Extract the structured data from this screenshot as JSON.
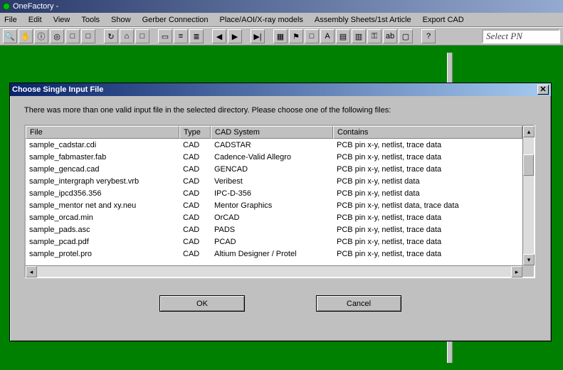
{
  "app": {
    "title": "OneFactory -"
  },
  "menus": [
    "File",
    "Edit",
    "View",
    "Tools",
    "Show",
    "Gerber Connection",
    "Place/AOI/X-ray models",
    "Assembly Sheets/1st Article",
    "Export CAD"
  ],
  "toolbar": {
    "icons": [
      "magnifier-icon",
      "hand-icon",
      "info-icon",
      "target-icon",
      "blank-icon",
      "blank-icon",
      "sep",
      "refresh-icon",
      "home-icon",
      "blank-icon",
      "sep",
      "rect-icon",
      "tool-a-icon",
      "tool-b-icon",
      "sep",
      "prev-icon",
      "next-icon",
      "sep",
      "step-icon",
      "sep",
      "layers-icon",
      "flag-icon",
      "blank-icon",
      "align-icon",
      "grid-icon",
      "table-icon",
      "key-icon",
      "text-icon",
      "color-icon",
      "sep",
      "help-icon"
    ],
    "glyphs": {
      "magnifier-icon": "🔍",
      "hand-icon": "✋",
      "info-icon": "ⓘ",
      "target-icon": "◎",
      "blank-icon": "□",
      "refresh-icon": "↻",
      "home-icon": "⌂",
      "rect-icon": "▭",
      "tool-a-icon": "≡",
      "tool-b-icon": "≣",
      "prev-icon": "◀",
      "next-icon": "▶",
      "step-icon": "▶|",
      "layers-icon": "▦",
      "flag-icon": "⚑",
      "align-icon": "A",
      "grid-icon": "▤",
      "table-icon": "▥",
      "key-icon": "⚿",
      "text-icon": "ab",
      "color-icon": "▢",
      "help-icon": "?"
    },
    "select_pn_placeholder": "Select PN"
  },
  "dialog": {
    "title": "Choose Single Input File",
    "message": "There was more than one valid input file in the selected directory.  Please choose one of the following files:",
    "columns": {
      "file": "File",
      "type": "Type",
      "cad": "CAD System",
      "contains": "Contains"
    },
    "rows": [
      {
        "file": "sample_cadstar.cdi",
        "type": "CAD",
        "cad": "CADSTAR",
        "contains": "PCB pin x-y, netlist, trace data"
      },
      {
        "file": "sample_fabmaster.fab",
        "type": "CAD",
        "cad": "Cadence-Valid Allegro",
        "contains": "PCB pin x-y, netlist, trace data"
      },
      {
        "file": "sample_gencad.cad",
        "type": "CAD",
        "cad": "GENCAD",
        "contains": "PCB pin x-y, netlist, trace data"
      },
      {
        "file": "sample_intergraph verybest.vrb",
        "type": "CAD",
        "cad": "Veribest",
        "contains": "PCB pin x-y, netlist data"
      },
      {
        "file": "sample_ipcd356.356",
        "type": "CAD",
        "cad": "IPC-D-356",
        "contains": "PCB pin x-y, netlist data"
      },
      {
        "file": "sample_mentor net and xy.neu",
        "type": "CAD",
        "cad": "Mentor Graphics",
        "contains": "PCB pin x-y, netlist data, trace data"
      },
      {
        "file": "sample_orcad.min",
        "type": "CAD",
        "cad": "OrCAD",
        "contains": "PCB pin x-y, netlist, trace data"
      },
      {
        "file": "sample_pads.asc",
        "type": "CAD",
        "cad": "PADS",
        "contains": "PCB pin x-y, netlist, trace data"
      },
      {
        "file": "sample_pcad.pdf",
        "type": "CAD",
        "cad": "PCAD",
        "contains": "PCB pin x-y, netlist, trace data"
      },
      {
        "file": "sample_protel.pro",
        "type": "CAD",
        "cad": "Altium Designer / Protel",
        "contains": "PCB pin x-y, netlist, trace data"
      }
    ],
    "ok_label": "OK",
    "cancel_label": "Cancel"
  }
}
